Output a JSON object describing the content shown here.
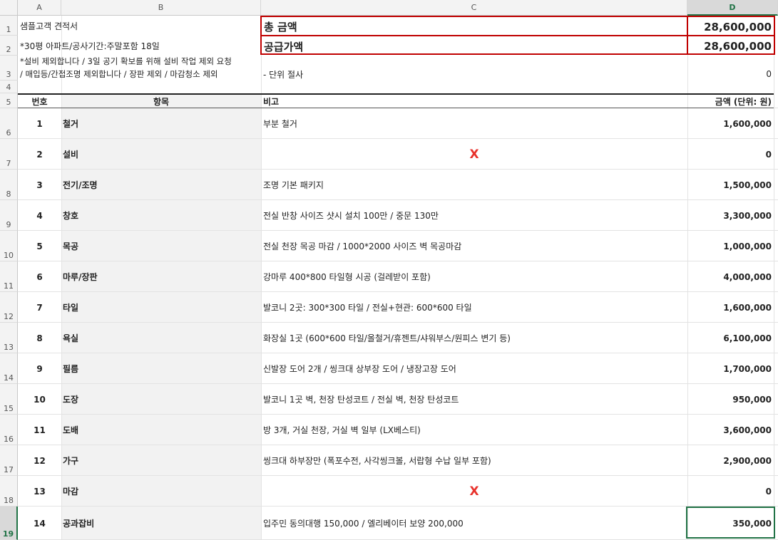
{
  "columns": [
    "A",
    "B",
    "C",
    "D"
  ],
  "row_numbers": [
    "1",
    "2",
    "3",
    "4",
    "5",
    "6",
    "7",
    "8",
    "9",
    "10",
    "11",
    "12",
    "13",
    "14",
    "15",
    "16",
    "17",
    "18",
    "19"
  ],
  "header": {
    "title": "샘플고객 견적서",
    "info": "*30평 아파트/공사기간:주말포함 18일",
    "note_line1": "*설비 제외합니다 / 3일 공기 확보를 위해 설비 작업 제외 요청",
    "note_line2": "/ 매입등/간접조명 제외합니다 / 장판 제외 / 마감청소 제외",
    "total_label": "총 금액",
    "total_value": "28,600,000",
    "supply_label": "공급가액",
    "supply_value": "28,600,000",
    "cut_label": "- 단위 절사",
    "cut_value": "0"
  },
  "table": {
    "col_no": "번호",
    "col_item": "항목",
    "col_note": "비고",
    "col_amount": "금액 (단위: 원)",
    "rows": [
      {
        "no": "1",
        "item": "철거",
        "note": "부분 철거",
        "amount": "1,600,000"
      },
      {
        "no": "2",
        "item": "설비",
        "note": "X",
        "amount": "0"
      },
      {
        "no": "3",
        "item": "전기/조명",
        "note": "조명 기본 패키지",
        "amount": "1,500,000"
      },
      {
        "no": "4",
        "item": "창호",
        "note": "전실 반창 사이즈 샷시 설치 100만 / 중문 130만",
        "amount": "3,300,000"
      },
      {
        "no": "5",
        "item": "목공",
        "note": "전실 천장 목공 마감 / 1000*2000 사이즈 벽 목공마감",
        "amount": "1,000,000"
      },
      {
        "no": "6",
        "item": "마루/장판",
        "note": "강마루 400*800 타일형 시공 (걸레받이 포함)",
        "amount": "4,000,000"
      },
      {
        "no": "7",
        "item": "타일",
        "note": "발코니 2곳: 300*300 타일 / 전실+현관: 600*600 타일",
        "amount": "1,600,000"
      },
      {
        "no": "8",
        "item": "욕실",
        "note": "화장실 1곳 (600*600 타일/올철거/휴젠트/샤워부스/원피스 변기 등)",
        "amount": "6,100,000"
      },
      {
        "no": "9",
        "item": "필름",
        "note": "신발장 도어 2개 / 씽크대 상부장 도어 / 냉장고장 도어",
        "amount": "1,700,000"
      },
      {
        "no": "10",
        "item": "도장",
        "note": "발코니 1곳 벽, 천장 탄성코트 / 전실 벽, 천장 탄성코트",
        "amount": "950,000"
      },
      {
        "no": "11",
        "item": "도배",
        "note": "방 3개, 거실 천장, 거실 벽 일부 (LX베스티)",
        "amount": "3,600,000"
      },
      {
        "no": "12",
        "item": "가구",
        "note": "씽크대 하부장만 (폭포수전, 사각씽크볼, 서랍형 수납 일부 포함)",
        "amount": "2,900,000"
      },
      {
        "no": "13",
        "item": "마감",
        "note": "X",
        "amount": "0"
      },
      {
        "no": "14",
        "item": "공과잡비",
        "note": "입주민 동의대행 150,000 / 엘리베이터 보양 200,000",
        "amount": "350,000"
      }
    ]
  },
  "colors": {
    "accent_red": "#c00000",
    "x_red": "#e8322c",
    "selection_green": "#217346"
  }
}
